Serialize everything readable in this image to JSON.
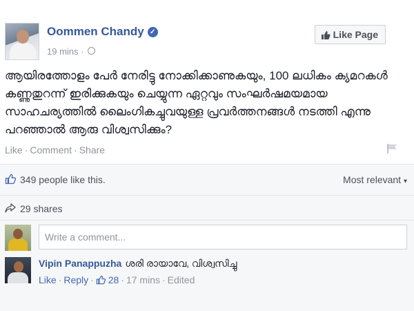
{
  "post": {
    "author": "Oommen Chandy",
    "time": "19 mins",
    "like_page_label": "Like Page",
    "text": "ആയിരത്തോളം പേർ നേരിട്ടു നോക്കിക്കാണുകയും, 100 ലധികം ക്യമറകൾ കണ്ണുതുറന്ന് ഇരിക്കുകയും ചെയ്യുന്ന ഏറ്റവും സംഘർഷമയമായ സാഹചര്യത്തിൽ ലൈംഗികച്ചുവയുള്ള പ്രവർത്തനങ്ങൾ നടത്തി എന്നു പറഞ്ഞാൽ ആരു വിശ്വസിക്കും?",
    "actions": {
      "like": "Like",
      "comment": "Comment",
      "share": "Share"
    }
  },
  "stats": {
    "likes_text": "349 people like this.",
    "sort_label": "Most relevant",
    "shares_text": "29 shares"
  },
  "composer": {
    "placeholder": "Write a comment..."
  },
  "comment": {
    "author": "Vipin Panappuzha",
    "text": "ശരി രായാവേ, വിശ്വസിച്ചു",
    "like": "Like",
    "reply": "Reply",
    "like_count": "28",
    "time": "17 mins",
    "edited": "Edited"
  },
  "colors": {
    "link": "#365899",
    "background": "#f6f7f9",
    "meta": "#90949c"
  }
}
